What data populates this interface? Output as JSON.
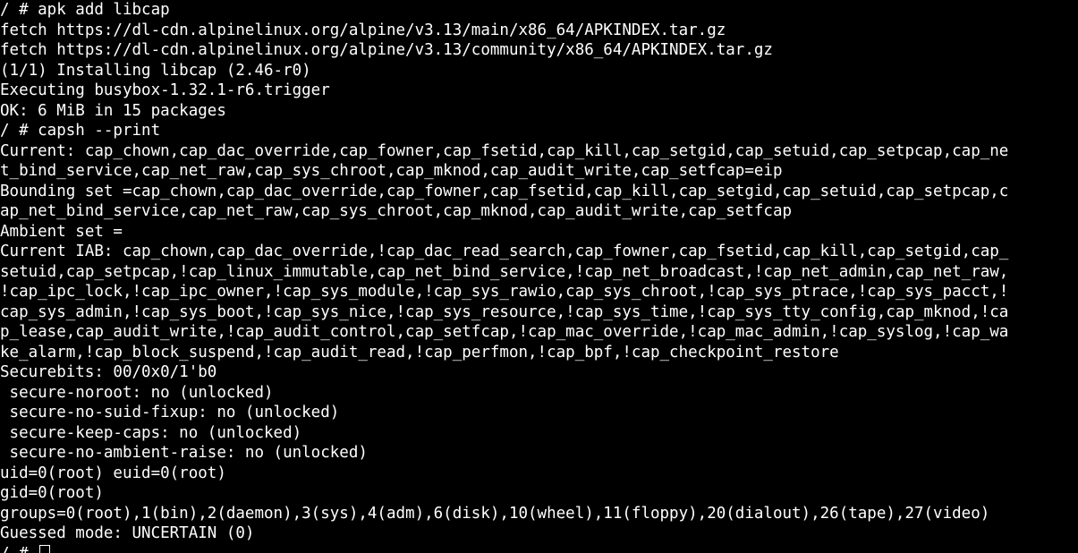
{
  "terminal": {
    "lines": [
      "/ # apk add libcap",
      "fetch https://dl-cdn.alpinelinux.org/alpine/v3.13/main/x86_64/APKINDEX.tar.gz",
      "fetch https://dl-cdn.alpinelinux.org/alpine/v3.13/community/x86_64/APKINDEX.tar.gz",
      "(1/1) Installing libcap (2.46-r0)",
      "Executing busybox-1.32.1-r6.trigger",
      "OK: 6 MiB in 15 packages",
      "/ # capsh --print",
      "Current: cap_chown,cap_dac_override,cap_fowner,cap_fsetid,cap_kill,cap_setgid,cap_setuid,cap_setpcap,cap_ne",
      "t_bind_service,cap_net_raw,cap_sys_chroot,cap_mknod,cap_audit_write,cap_setfcap=eip",
      "Bounding set =cap_chown,cap_dac_override,cap_fowner,cap_fsetid,cap_kill,cap_setgid,cap_setuid,cap_setpcap,c",
      "ap_net_bind_service,cap_net_raw,cap_sys_chroot,cap_mknod,cap_audit_write,cap_setfcap",
      "Ambient set =",
      "Current IAB: cap_chown,cap_dac_override,!cap_dac_read_search,cap_fowner,cap_fsetid,cap_kill,cap_setgid,cap_",
      "setuid,cap_setpcap,!cap_linux_immutable,cap_net_bind_service,!cap_net_broadcast,!cap_net_admin,cap_net_raw,",
      "!cap_ipc_lock,!cap_ipc_owner,!cap_sys_module,!cap_sys_rawio,cap_sys_chroot,!cap_sys_ptrace,!cap_sys_pacct,!",
      "cap_sys_admin,!cap_sys_boot,!cap_sys_nice,!cap_sys_resource,!cap_sys_time,!cap_sys_tty_config,cap_mknod,!ca",
      "p_lease,cap_audit_write,!cap_audit_control,cap_setfcap,!cap_mac_override,!cap_mac_admin,!cap_syslog,!cap_wa",
      "ke_alarm,!cap_block_suspend,!cap_audit_read,!cap_perfmon,!cap_bpf,!cap_checkpoint_restore",
      "Securebits: 00/0x0/1'b0",
      " secure-noroot: no (unlocked)",
      " secure-no-suid-fixup: no (unlocked)",
      " secure-keep-caps: no (unlocked)",
      " secure-no-ambient-raise: no (unlocked)",
      "uid=0(root) euid=0(root)",
      "gid=0(root)",
      "groups=0(root),1(bin),2(daemon),3(sys),4(adm),6(disk),10(wheel),11(floppy),20(dialout),26(tape),27(video)",
      "Guessed mode: UNCERTAIN (0)"
    ],
    "prompt": "/ # ",
    "colors": {
      "background": "#000000",
      "foreground": "#ffffff"
    }
  }
}
